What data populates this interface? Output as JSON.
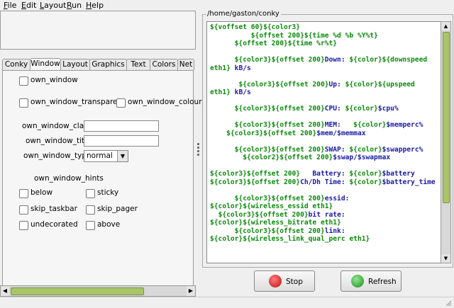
{
  "menu": [
    {
      "label": "File",
      "u": "F",
      "rest": "ile"
    },
    {
      "label": "Edit",
      "u": "E",
      "rest": "dit"
    },
    {
      "label": "Layout",
      "u": "L",
      "rest": "ayout"
    },
    {
      "label": "Run",
      "u": "R",
      "rest": "un"
    },
    {
      "label": "Help",
      "u": "H",
      "rest": "elp"
    }
  ],
  "tabs": [
    "Conky",
    "Window",
    "Layout",
    "Graphics",
    "Text",
    "Colors",
    "Net"
  ],
  "active_tab": "Window",
  "window": {
    "own_window": "own_window",
    "own_window_transparent": "own_window_transparent",
    "own_window_colour": "own_window_colour",
    "own_window_class_label": "own_window_class",
    "own_window_class_value": "",
    "own_window_title_label": "own_window_title",
    "own_window_title_value": "",
    "own_window_type_label": "own_window_type",
    "own_window_type_value": "normal",
    "hints_label": "own_window_hints",
    "hints": {
      "below": "below",
      "sticky": "sticky",
      "skip_taskbar": "skip_taskbar",
      "skip_pager": "skip_pager",
      "undecorated": "undecorated",
      "above": "above"
    }
  },
  "editor": {
    "path": "/home/gaston/conky"
  },
  "buttons": {
    "stop": "Stop",
    "refresh": "Refresh"
  },
  "colors": {
    "accent_green": "#aac46a",
    "code_green": "#0b8a0b",
    "code_blue": "#1a1aa6",
    "stop_red": "#d22",
    "refresh_green": "#2a2"
  }
}
